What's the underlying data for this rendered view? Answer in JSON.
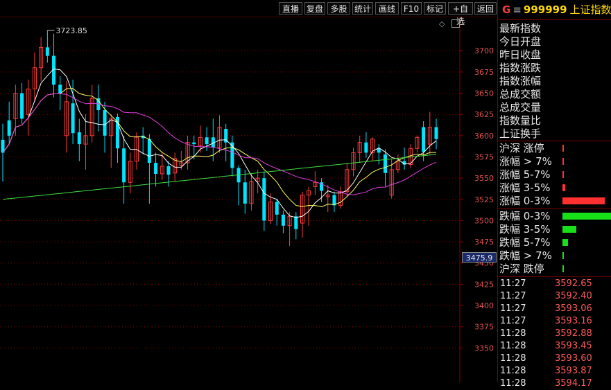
{
  "toolbar": [
    "直播",
    "复盘",
    "多股",
    "统计",
    "画线",
    "F10",
    "标记",
    "+自选",
    "返回"
  ],
  "stock": {
    "flag": "G",
    "eq": "≡",
    "code": "999999",
    "name": "上证指数"
  },
  "info_labels": [
    "最新指数",
    "今日开盘",
    "昨日收盘",
    "指数涨跌",
    "指数涨幅",
    "总成交额",
    "总成交量",
    "指数量比",
    "上证换手"
  ],
  "dist": [
    {
      "label": "沪深 涨停",
      "color": "#ff3030",
      "value": 2
    },
    {
      "label": "涨幅 > 7%",
      "color": "#ff3030",
      "value": 2
    },
    {
      "label": "涨幅 5-7%",
      "color": "#ff3030",
      "value": 2
    },
    {
      "label": "涨幅 3-5%",
      "color": "#ff3030",
      "value": 4
    },
    {
      "label": "涨幅 0-3%",
      "color": "#ff3030",
      "value": 62
    },
    {
      "label": "跌幅 0-3%",
      "color": "#18e018",
      "value": 72
    },
    {
      "label": "跌幅 3-5%",
      "color": "#18e018",
      "value": 20
    },
    {
      "label": "跌幅 5-7%",
      "color": "#18e018",
      "value": 8
    },
    {
      "label": "跌幅 > 7%",
      "color": "#18e018",
      "value": 2
    },
    {
      "label": "沪深 跌停",
      "color": "#18e018",
      "value": 1
    }
  ],
  "ticks": [
    {
      "time": "11:27",
      "price": "3592.65"
    },
    {
      "time": "11:27",
      "price": "3592.40"
    },
    {
      "time": "11:27",
      "price": "3593.06"
    },
    {
      "time": "11:27",
      "price": "3593.16"
    },
    {
      "time": "11:28",
      "price": "3592.88"
    },
    {
      "time": "11:28",
      "price": "3593.45"
    },
    {
      "time": "11:28",
      "price": "3593.60"
    },
    {
      "time": "11:28",
      "price": "3593.87"
    },
    {
      "time": "11:28",
      "price": "3594.17"
    }
  ],
  "last_price_label": "3475.9",
  "max_label": "3723.85",
  "chart_data": {
    "type": "candlestick",
    "ylim": [
      3350,
      3725
    ],
    "yticks": [
      3350,
      3375,
      3400,
      3425,
      3450,
      3475,
      3500,
      3525,
      3550,
      3575,
      3600,
      3625,
      3650,
      3675,
      3700
    ],
    "colors": {
      "up": "#ff3c3c",
      "down": "#00e5ff",
      "ma5": "#ffffff",
      "ma10": "#ffff60",
      "ma20": "#e040e0",
      "ma60": "#40e040",
      "grid": "#8b0000"
    },
    "candles": [
      [
        3595,
        3580,
        3614,
        3546
      ],
      [
        3618,
        3600,
        3640,
        3590
      ],
      [
        3620,
        3650,
        3660,
        3600
      ],
      [
        3650,
        3620,
        3662,
        3614
      ],
      [
        3625,
        3655,
        3666,
        3600
      ],
      [
        3655,
        3680,
        3698,
        3640
      ],
      [
        3680,
        3704,
        3716,
        3664
      ],
      [
        3704,
        3694,
        3724,
        3686
      ],
      [
        3694,
        3660,
        3720,
        3645
      ],
      [
        3660,
        3650,
        3670,
        3630
      ],
      [
        3600,
        3640,
        3664,
        3580
      ],
      [
        3638,
        3603,
        3666,
        3590
      ],
      [
        3604,
        3590,
        3620,
        3570
      ],
      [
        3590,
        3600,
        3625,
        3560
      ],
      [
        3600,
        3644,
        3660,
        3592
      ],
      [
        3644,
        3630,
        3660,
        3605
      ],
      [
        3630,
        3600,
        3640,
        3580
      ],
      [
        3600,
        3620,
        3625,
        3562
      ],
      [
        3622,
        3585,
        3626,
        3568
      ],
      [
        3585,
        3545,
        3600,
        3520
      ],
      [
        3545,
        3570,
        3580,
        3532
      ],
      [
        3570,
        3599,
        3604,
        3560
      ],
      [
        3600,
        3597,
        3610,
        3578
      ],
      [
        3596,
        3568,
        3602,
        3520
      ],
      [
        3568,
        3555,
        3580,
        3540
      ],
      [
        3555,
        3564,
        3580,
        3548
      ],
      [
        3564,
        3554,
        3570,
        3540
      ],
      [
        3556,
        3573,
        3580,
        3546
      ],
      [
        3565,
        3568,
        3582,
        3560
      ],
      [
        3568,
        3592,
        3600,
        3560
      ],
      [
        3592,
        3590,
        3600,
        3572
      ],
      [
        3588,
        3598,
        3612,
        3580
      ],
      [
        3598,
        3590,
        3610,
        3582
      ],
      [
        3598,
        3586,
        3620,
        3570
      ],
      [
        3586,
        3610,
        3624,
        3580
      ],
      [
        3608,
        3592,
        3614,
        3570
      ],
      [
        3592,
        3562,
        3600,
        3552
      ],
      [
        3562,
        3545,
        3565,
        3518
      ],
      [
        3545,
        3520,
        3560,
        3508
      ],
      [
        3520,
        3546,
        3555,
        3512
      ],
      [
        3546,
        3550,
        3560,
        3532
      ],
      [
        3550,
        3500,
        3558,
        3488
      ],
      [
        3500,
        3522,
        3532,
        3496
      ],
      [
        3522,
        3507,
        3526,
        3494
      ],
      [
        3507,
        3494,
        3512,
        3485
      ],
      [
        3494,
        3505,
        3510,
        3470
      ],
      [
        3505,
        3490,
        3510,
        3478
      ],
      [
        3497,
        3530,
        3534,
        3480
      ],
      [
        3530,
        3535,
        3540,
        3494
      ],
      [
        3540,
        3545,
        3558,
        3530
      ],
      [
        3545,
        3535,
        3550,
        3522
      ],
      [
        3528,
        3530,
        3542,
        3510
      ],
      [
        3530,
        3518,
        3534,
        3510
      ],
      [
        3518,
        3534,
        3540,
        3514
      ],
      [
        3534,
        3560,
        3568,
        3528
      ],
      [
        3560,
        3580,
        3586,
        3552
      ],
      [
        3580,
        3592,
        3600,
        3568
      ],
      [
        3592,
        3580,
        3604,
        3574
      ],
      [
        3580,
        3596,
        3598,
        3570
      ],
      [
        3585,
        3580,
        3590,
        3566
      ],
      [
        3578,
        3556,
        3584,
        3540
      ],
      [
        3530,
        3560,
        3572,
        3526
      ],
      [
        3560,
        3570,
        3578,
        3556
      ],
      [
        3570,
        3566,
        3586,
        3560
      ],
      [
        3566,
        3585,
        3590,
        3562
      ],
      [
        3585,
        3598,
        3600,
        3580
      ],
      [
        3610,
        3581,
        3617,
        3570
      ],
      [
        3590,
        3610,
        3628,
        3578
      ],
      [
        3610,
        3596,
        3620,
        3584
      ]
    ]
  }
}
